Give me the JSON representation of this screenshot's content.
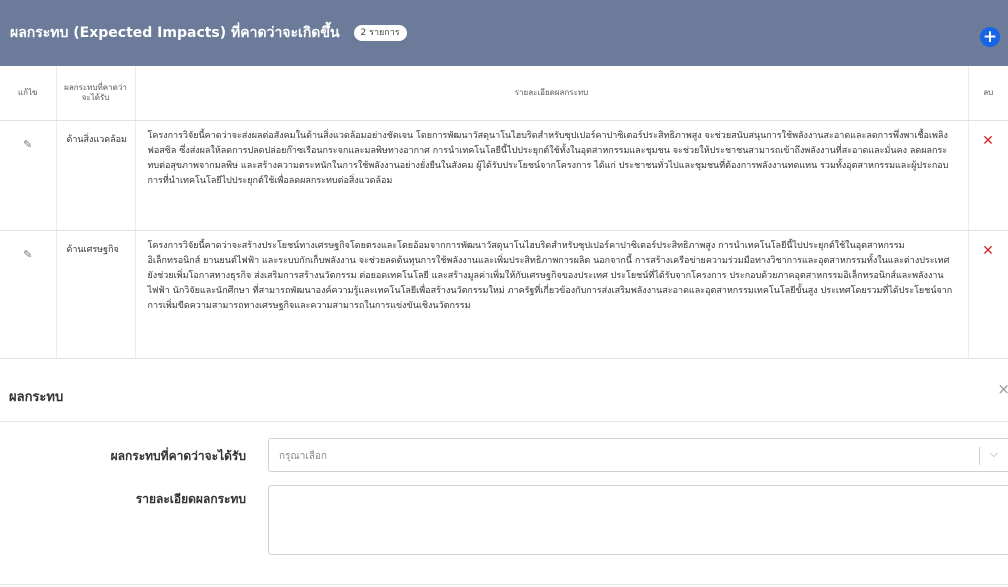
{
  "panel": {
    "title": "ผลกระทบ (Expected Impacts) ที่คาดว่าจะเกิดขึ้น",
    "badge": "2 รายการ",
    "add_icon": "+"
  },
  "table": {
    "headers": {
      "edit": "แก้ไข",
      "type": "ผลกระทบที่คาดว่าจะได้รับ",
      "detail": "รายละเอียดผลกระทบ",
      "delete": "ลบ"
    },
    "rows": [
      {
        "type": "ด้านสิ่งแวดล้อม",
        "detail": "โครงการวิจัยนี้คาดว่าจะส่งผลต่อสังคมในด้านสิ่งแวดล้อมอย่างชัดเจน โดยการพัฒนาวัสดุนาโนไฮบริดสำหรับซุปเปอร์คาปาซิเตอร์ประสิทธิภาพสูง จะช่วยสนับสนุนการใช้พลังงานสะอาดและลดการพึ่งพาเชื้อเพลิงฟอสซิล ซึ่งส่งผลให้ลดการปลดปล่อยก๊าซเรือนกระจกและมลพิษทางอากาศ การนำเทคโนโลยีนี้ไปประยุกต์ใช้ทั้งในอุตสาหกรรมและชุมชน จะช่วยให้ประชาชนสามารถเข้าถึงพลังงานที่สะอาดและมั่นคง ลดผลกระทบต่อสุขภาพจากมลพิษ และสร้างความตระหนักในการใช้พลังงานอย่างยั่งยืนในสังคม ผู้ได้รับประโยชน์จากโครงการ ได้แก่ ประชาชนทั่วไปและชุมชนที่ต้องการพลังงานทดแทน รวมทั้งอุตสาหกรรมและผู้ประกอบการที่นำเทคโนโลยีไปประยุกต์ใช้เพื่อลดผลกระทบต่อสิ่งแวดล้อม"
      },
      {
        "type": "ด้านเศรษฐกิจ",
        "detail": "โครงการวิจัยนี้คาดว่าจะสร้างประโยชน์ทางเศรษฐกิจโดยตรงและโดยอ้อมจากการพัฒนาวัสดุนาโนไฮบริดสำหรับซุปเปอร์คาปาซิเตอร์ประสิทธิภาพสูง การนำเทคโนโลยีนี้ไปประยุกต์ใช้ในอุตสาหกรรมอิเล็กทรอนิกส์ ยานยนต์ไฟฟ้า และระบบกักเก็บพลังงาน จะช่วยลดต้นทุนการใช้พลังงานและเพิ่มประสิทธิภาพการผลิต นอกจากนี้ การสร้างเครือข่ายความร่วมมือทางวิชาการและอุตสาหกรรมทั้งในและต่างประเทศยังช่วยเพิ่มโอกาสทางธุรกิจ ส่งเสริมการสร้างนวัตกรรม ต่อยอดเทคโนโลยี และสร้างมูลค่าเพิ่มให้กับเศรษฐกิจของประเทศ ประโยชน์ที่ได้รับจากโครงการ ประกอบด้วยภาคอุตสาหกรรมอิเล็กทรอนิกส์และพลังงานไฟฟ้า นักวิจัยและนักศึกษา ที่สามารถพัฒนาองค์ความรู้และเทคโนโลยีเพื่อสร้างนวัตกรรมใหม่ ภาครัฐที่เกี่ยวข้องกับการส่งเสริมพลังงานสะอาดและอุตสาหกรรมเทคโนโลยีขั้นสูง ประเทศโดยรวมที่ได้ประโยชน์จากการเพิ่มขีดความสามารถทางเศรษฐกิจและความสามารถในการแข่งขันเชิงนวัตกรรม"
      }
    ],
    "edit_icon": "✎",
    "delete_icon": "✕"
  },
  "modal": {
    "title": "ผลกระทบ",
    "close_icon": "×",
    "fields": {
      "impact_label": "ผลกระทบที่คาดว่าจะได้รับ",
      "impact_value": "",
      "impact_placeholder": "กรุณาเลือก",
      "detail_label": "รายละเอียดผลกระทบ",
      "detail_value": ""
    },
    "select_arrow_icon": "chevron-down-icon"
  },
  "colors": {
    "header_bg": "#6b7b99",
    "add_button": "#1565e6",
    "delete_icon": "#d9262c"
  }
}
